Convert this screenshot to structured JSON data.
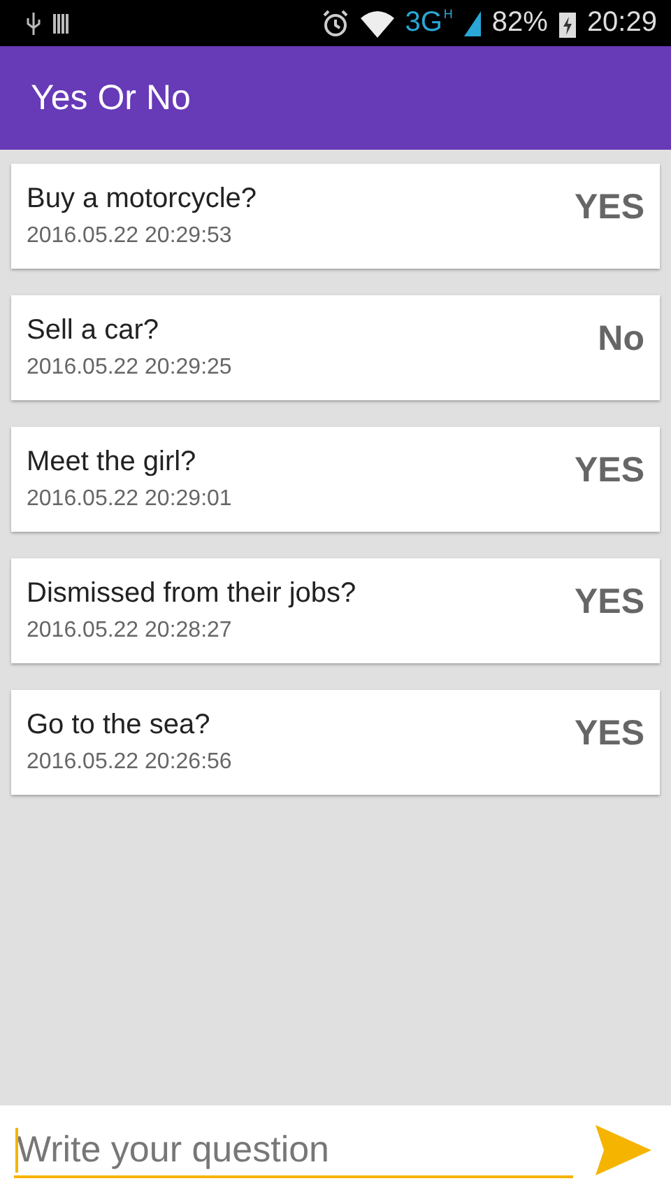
{
  "status_bar": {
    "network": "3G",
    "network_sub": "H",
    "battery": "82%",
    "time": "20:29"
  },
  "app_bar": {
    "title": "Yes Or No"
  },
  "questions": [
    {
      "question": "Buy a motorcycle?",
      "timestamp": "2016.05.22 20:29:53",
      "answer": "YES"
    },
    {
      "question": "Sell a car?",
      "timestamp": "2016.05.22 20:29:25",
      "answer": "No"
    },
    {
      "question": "Meet the girl?",
      "timestamp": "2016.05.22 20:29:01",
      "answer": "YES"
    },
    {
      "question": "Dismissed from their jobs?",
      "timestamp": "2016.05.22 20:28:27",
      "answer": "YES"
    },
    {
      "question": "Go to the sea?",
      "timestamp": "2016.05.22 20:26:56",
      "answer": "YES"
    }
  ],
  "composer": {
    "placeholder": "Write your question"
  }
}
